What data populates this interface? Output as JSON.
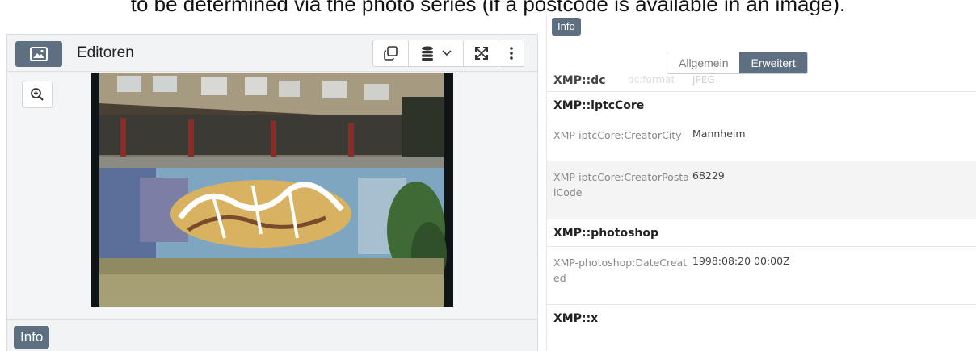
{
  "caption": "to be determined via the photo series (if a postcode is available in an image).",
  "left": {
    "title": "Editoren",
    "info_label": "Info",
    "icons": {
      "image_mode": "image-icon",
      "copy": "copy-icon",
      "database": "database-icon",
      "dropdown": "chevron-down-icon",
      "expand": "expand-icon",
      "more": "more-vertical-icon",
      "zoom": "zoom-in-icon"
    },
    "accent": "#5d6f80"
  },
  "right": {
    "info_label": "Info",
    "tabs": {
      "general": "Allgemein",
      "extended": "Erweitert",
      "active": "Erweitert"
    },
    "dc": {
      "name": "XMP::dc",
      "faded_key": "dc:format",
      "faded_value": "JPEG"
    },
    "sections": [
      {
        "name": "XMP::iptcCore",
        "fields": [
          {
            "key": "XMP-iptcCore:CreatorCity",
            "value": "Mannheim"
          },
          {
            "key": "XMP-iptcCore:CreatorPostalCode",
            "value": "68229"
          }
        ]
      },
      {
        "name": "XMP::photoshop",
        "fields": [
          {
            "key": "XMP-photoshop:DateCreated",
            "value": "1998:08:20 00:00Z"
          }
        ]
      },
      {
        "name": "XMP::x",
        "fields": []
      }
    ]
  }
}
